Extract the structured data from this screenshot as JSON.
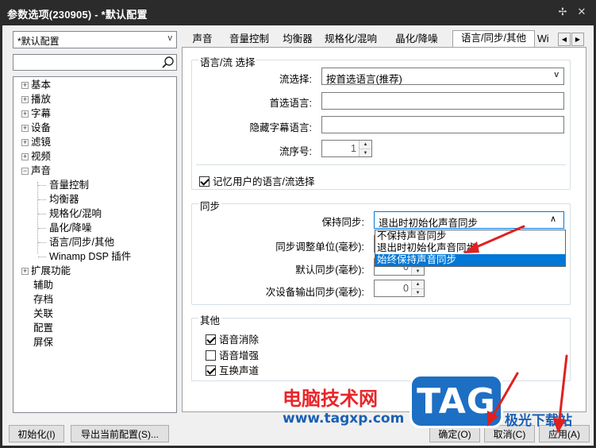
{
  "window": {
    "title": "参数选项(230905) - *默认配置",
    "pin_glyph": "✢",
    "close_glyph": "✕"
  },
  "left": {
    "profile": "*默认配置",
    "search_placeholder": "",
    "tree": [
      {
        "label": "基本",
        "expander": "+"
      },
      {
        "label": "播放",
        "expander": "+"
      },
      {
        "label": "字幕",
        "expander": "+"
      },
      {
        "label": "设备",
        "expander": "+"
      },
      {
        "label": "滤镜",
        "expander": "+"
      },
      {
        "label": "视频",
        "expander": "+"
      },
      {
        "label": "声音",
        "expander": "−",
        "children": [
          "音量控制",
          "均衡器",
          "规格化/混响",
          "晶化/降噪",
          "语言/同步/其他",
          "Winamp DSP 插件"
        ]
      },
      {
        "label": "扩展功能",
        "expander": "+"
      },
      {
        "label": "辅助"
      },
      {
        "label": "存档"
      },
      {
        "label": "关联"
      },
      {
        "label": "配置"
      },
      {
        "label": "屏保"
      }
    ]
  },
  "bottom_buttons": {
    "init": "初始化(I)",
    "export": "导出当前配置(S)...",
    "ok": "确定(O)",
    "cancel": "取消(C)",
    "apply": "应用(A)"
  },
  "tabs": {
    "items": [
      "声音",
      "音量控制",
      "均衡器",
      "规格化/混响",
      "晶化/降噪",
      "语言/同步/其他",
      "Wi"
    ],
    "active_index": 5,
    "scroll_left": "◀",
    "scroll_right": "▶"
  },
  "lang_group": {
    "title": "语言/流 选择",
    "stream_select_label": "流选择:",
    "stream_select_value": "按首选语言(推荐)",
    "preferred_lang_label": "首选语言:",
    "preferred_lang_value": "",
    "hidden_sub_lang_label": "隐藏字幕语言:",
    "hidden_sub_lang_value": "",
    "stream_no_label": "流序号:",
    "stream_no_value": "1",
    "remember_label": "记忆用户的语言/流选择",
    "remember_checked": true
  },
  "sync_group": {
    "title": "同步",
    "keep_sync_label": "保持同步:",
    "keep_sync_value": "退出时初始化声音同步",
    "keep_sync_arrow": "∧",
    "options": [
      "不保持声音同步",
      "退出时初始化声音同步",
      "始终保持声音同步"
    ],
    "highlighted_option": 2,
    "adjust_unit_label": "同步调整单位(毫秒):",
    "default_sync_label": "默认同步(毫秒):",
    "default_sync_value": "0",
    "secondary_sync_label": "次设备输出同步(毫秒):",
    "secondary_sync_value": "0"
  },
  "other_group": {
    "title": "其他",
    "items": [
      {
        "label": "语音消除",
        "checked": true
      },
      {
        "label": "语音增强",
        "checked": false
      },
      {
        "label": "互换声道",
        "checked": true
      }
    ]
  },
  "watermark": {
    "site_name": "电脑技术网",
    "site_url": "www.tagxp.com",
    "logo_text": "TAG",
    "corner_text": "极光下载站"
  },
  "colors": {
    "annotation_red": "#e02020",
    "selection_blue": "#0078d7",
    "watermark_red": "#e8262a",
    "watermark_blue": "#1a5fb4"
  }
}
